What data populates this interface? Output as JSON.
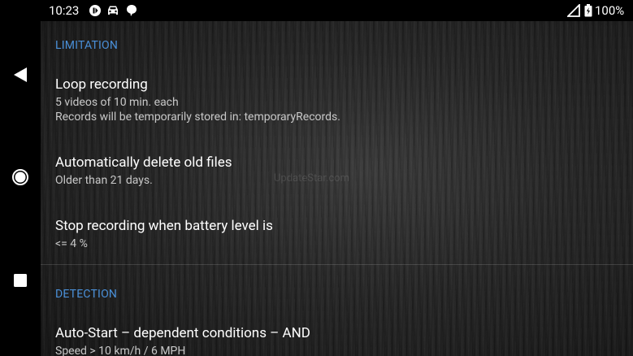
{
  "status_bar": {
    "time": "10:23",
    "battery_percent": "100%",
    "icons": [
      "media-icon",
      "car-icon",
      "chat-bubble-icon",
      "signal-icon",
      "battery-icon"
    ]
  },
  "nav_bar": {
    "buttons": [
      "back-triangle-icon",
      "home-circle-icon",
      "recents-square-icon"
    ]
  },
  "sections": {
    "limitation": {
      "header": "LIMITATION",
      "loop": {
        "title": "Loop recording",
        "summary_line1": "5 videos of 10 min. each",
        "summary_line2": "Records will be temporarily stored in: temporaryRecords."
      },
      "auto_delete": {
        "title": "Automatically delete old files",
        "summary": "Older than 21 days."
      },
      "battery": {
        "title": "Stop recording when battery level is",
        "summary": "<= 4 %"
      }
    },
    "detection": {
      "header": "DETECTION",
      "auto_start": {
        "title": "Auto-Start – dependent conditions – AND",
        "summary": "Speed > 10 km/h / 6 MPH"
      }
    }
  },
  "watermark": "UpdateStar.com",
  "colors": {
    "accent": "#4a90d9",
    "background": "#262626"
  }
}
